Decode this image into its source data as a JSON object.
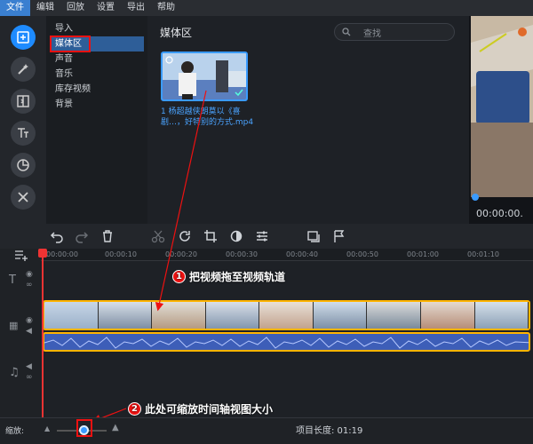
{
  "menu": {
    "items": [
      "文件",
      "编辑",
      "回放",
      "设置",
      "导出",
      "帮助"
    ]
  },
  "side_nav": {
    "items": [
      "导入",
      "媒体区",
      "声音",
      "音乐",
      "库存视频",
      "背景"
    ]
  },
  "media": {
    "title": "媒体区",
    "search_placeholder": "查找",
    "clip_name": "1 杨超越侠朗莫以《喜剧…，好特别的方式.mp4"
  },
  "preview": {
    "timecode": "00:00:00."
  },
  "timeline": {
    "ticks": [
      "00:00:00",
      "00:00:10",
      "00:00:20",
      "00:00:30",
      "00:00:40",
      "00:00:50",
      "00:01:00",
      "00:01:10"
    ]
  },
  "annotations": {
    "a1_num": "1",
    "a1_text": "把视频拖至视频轨道",
    "a2_num": "2",
    "a2_text": "此处可缩放时间轴视图大小"
  },
  "bottom": {
    "zoom_label": "缩放:",
    "project_length": "项目长度: 01:19"
  },
  "colors": {
    "accent": "#1e8bff",
    "highlight": "#ffb400",
    "annotation": "#e11111"
  }
}
